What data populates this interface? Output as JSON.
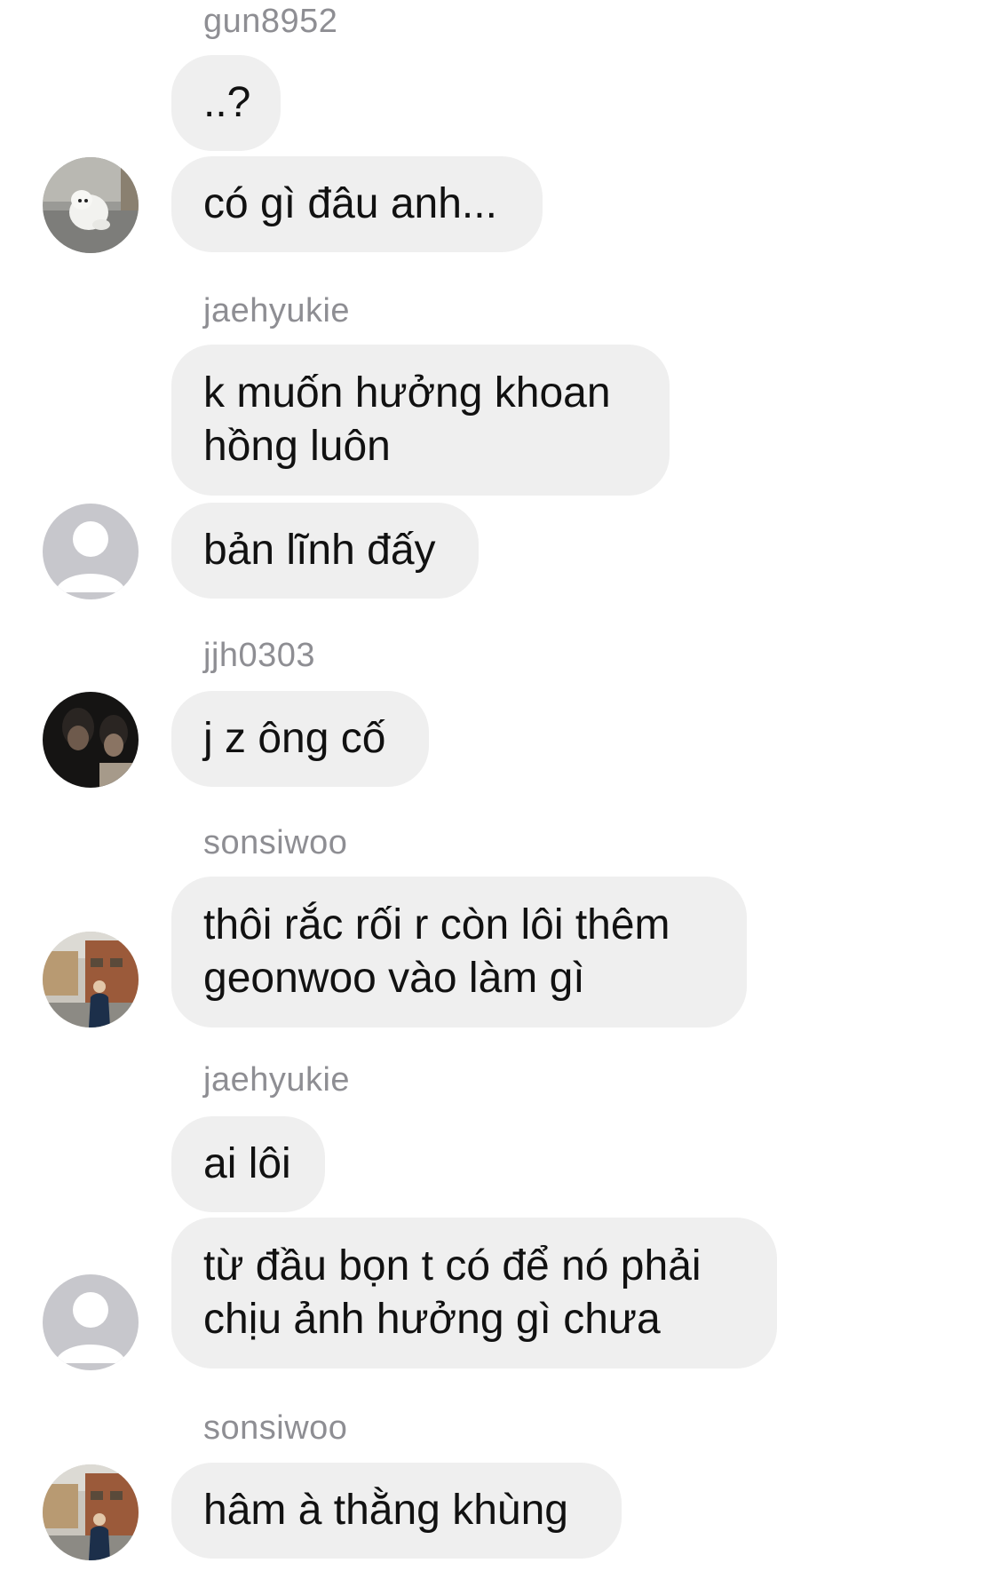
{
  "conversation": {
    "messages": [
      {
        "username": "gun8952",
        "bubbles": [
          "..?",
          "có gì đâu anh..."
        ],
        "avatar": "dog-photo-avatar"
      },
      {
        "username": "jaehyukie",
        "bubbles": [
          "k muốn hưởng khoan\nhồng luôn",
          "bản lĩnh đấy"
        ],
        "avatar": "default-user-avatar"
      },
      {
        "username": "jjh0303",
        "bubbles": [
          "j z ông cố"
        ],
        "avatar": "two-people-dark-photo-avatar"
      },
      {
        "username": "sonsiwoo",
        "bubbles": [
          "thôi rắc rối r còn lôi thêm\ngeonwoo vào làm gì"
        ],
        "avatar": "street-person-photo-avatar"
      },
      {
        "username": "jaehyukie",
        "bubbles": [
          "ai lôi",
          "từ đầu bọn t có để nó phải\nchịu ảnh hưởng gì chưa"
        ],
        "avatar": "default-user-avatar"
      },
      {
        "username": "sonsiwoo",
        "bubbles": [
          "hâm à thằng khùng"
        ],
        "avatar": "street-person-photo-avatar"
      }
    ]
  },
  "colors": {
    "bubble_bg": "#efefef",
    "username_text": "#8e8e93",
    "message_text": "#111111",
    "default_avatar_bg": "#c7c7cc"
  }
}
